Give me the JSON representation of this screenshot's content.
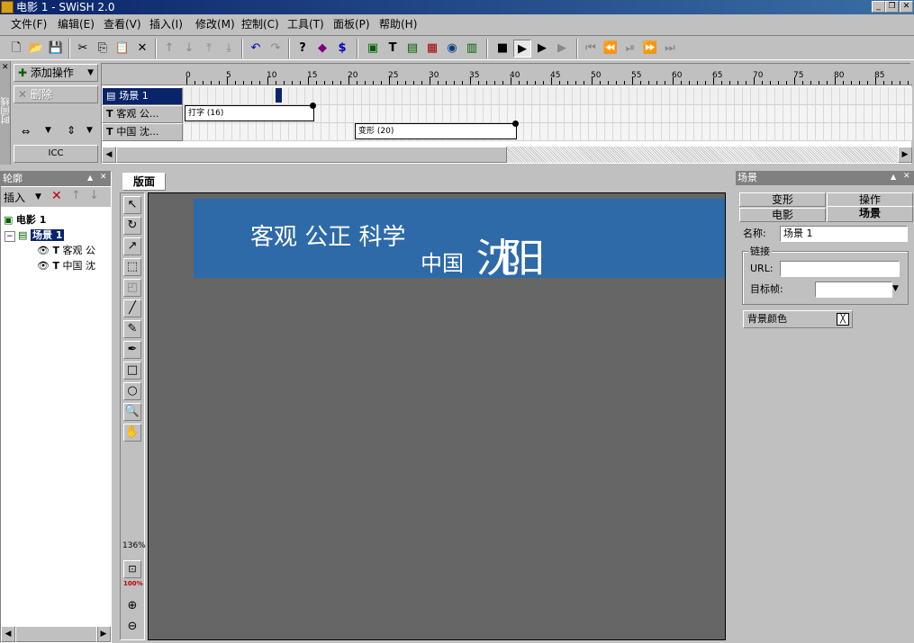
{
  "window": {
    "title": "电影 1 - SWiSH 2.0"
  },
  "menu": [
    "文件(F)",
    "编辑(E)",
    "查看(V)",
    "插入(I)",
    "修改(M)",
    "控制(C)",
    "工具(T)",
    "面板(P)",
    "帮助(H)"
  ],
  "timeline": {
    "side_label": "时间线",
    "add_action_label": "添加操作",
    "delete_label": "删除",
    "rewind_label": "ICC",
    "ruler_ticks": [
      "0",
      "5",
      "10",
      "15",
      "20",
      "25",
      "30",
      "35",
      "40",
      "45",
      "50",
      "55",
      "60",
      "65",
      "70",
      "75",
      "80",
      "85"
    ],
    "layers": [
      {
        "name": "场景 1"
      },
      {
        "name": "客观 公..."
      },
      {
        "name": "中国 沈..."
      }
    ],
    "tweens": [
      {
        "label": "打字 (16)",
        "start": 0,
        "end": 16
      },
      {
        "label": "变形 (20)",
        "start": 21,
        "end": 41
      }
    ],
    "playhead": 11
  },
  "outline": {
    "title": "轮廓",
    "insert_label": "插入",
    "tree": {
      "movie": "电影 1",
      "scene": "场景 1",
      "items": [
        "客观 公",
        "中国 沈"
      ]
    }
  },
  "canvas": {
    "tab": "版面",
    "zoom": "136%",
    "zoom_100": "100%",
    "banner_color": "#2e6aa8",
    "text1": "客观 公正 科学",
    "text2": "中国",
    "text3": "沈阳"
  },
  "props": {
    "title": "场景",
    "tabs_row1": [
      "变形",
      "操作"
    ],
    "tabs_row2": [
      "电影",
      "场景"
    ],
    "name_label": "名称:",
    "name_value": "场景 1",
    "link_group": "链接",
    "url_label": "URL:",
    "url_value": "",
    "target_label": "目标帧:",
    "target_value": "",
    "bg_label": "背景颜色"
  }
}
